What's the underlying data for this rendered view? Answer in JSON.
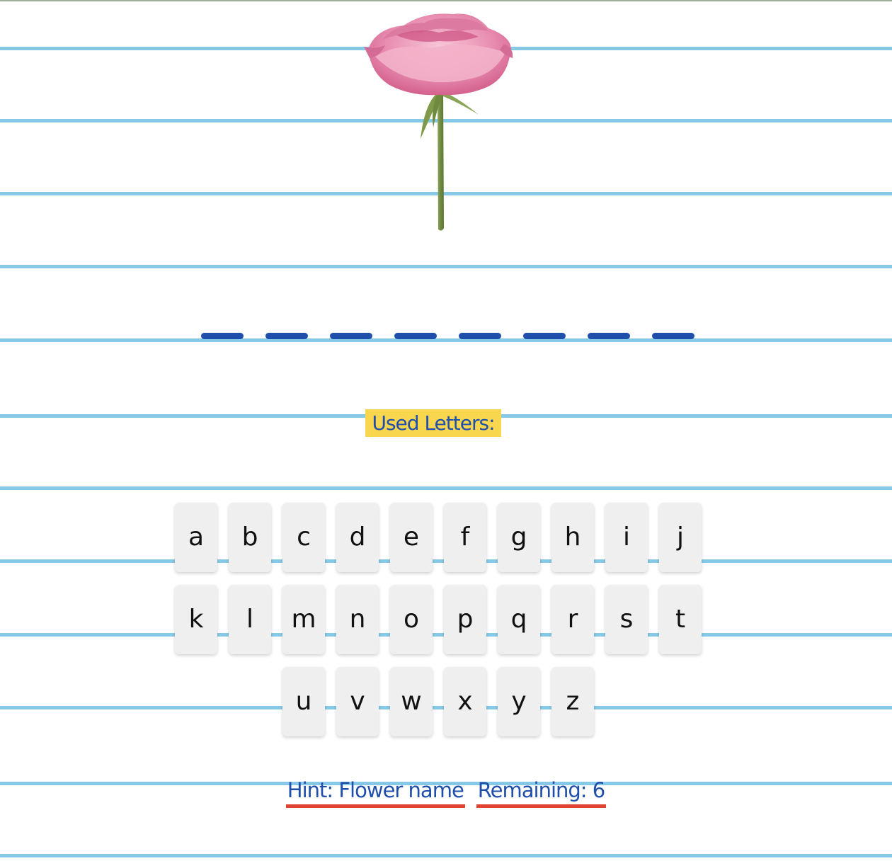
{
  "game": {
    "image": "pink-rose",
    "word_length": 8,
    "used_letters_label": "Used Letters:",
    "used_letters": ""
  },
  "keyboard": {
    "rows": [
      [
        "a",
        "b",
        "c",
        "d",
        "e",
        "f",
        "g",
        "h",
        "i",
        "j"
      ],
      [
        "k",
        "l",
        "m",
        "n",
        "o",
        "p",
        "q",
        "r",
        "s",
        "t"
      ],
      [
        "u",
        "v",
        "w",
        "x",
        "y",
        "z"
      ]
    ]
  },
  "footer": {
    "hint": "Hint: Flower name",
    "remaining": "Remaining: 6"
  },
  "colors": {
    "ruled_line": "#86c9e6",
    "slot": "#1f4eab",
    "highlight": "#f8d64e",
    "text_blue": "#1f4eab",
    "underline_red": "#e0432e",
    "key_bg": "#efefef"
  }
}
